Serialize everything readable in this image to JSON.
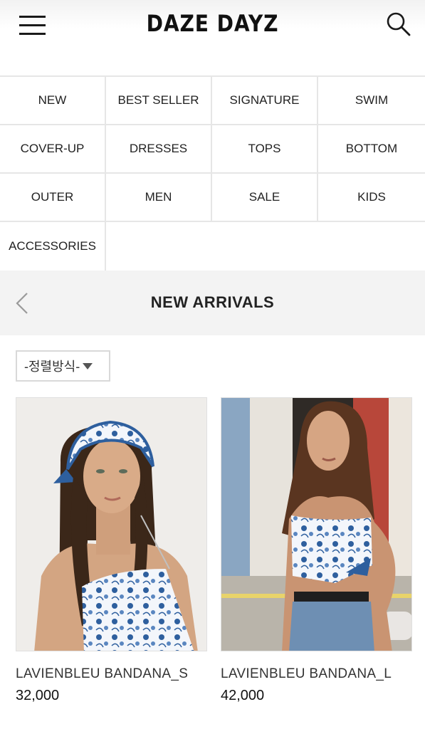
{
  "header": {
    "logo": "DAZE DAYZ",
    "menu_icon": "hamburger-menu-icon",
    "search_icon": "search-icon"
  },
  "categories": [
    "NEW",
    "BEST SELLER",
    "SIGNATURE",
    "SWIM",
    "COVER-UP",
    "DRESSES",
    "TOPS",
    "BOTTOM",
    "OUTER",
    "MEN",
    "SALE",
    "KIDS",
    "ACCESSORIES"
  ],
  "section": {
    "title": "NEW ARRIVALS",
    "back_icon": "chevron-left-icon"
  },
  "sort": {
    "label": "-정렬방식-"
  },
  "products": [
    {
      "name": "LAVIENBLEU BANDANA_S",
      "price": "32,000"
    },
    {
      "name": "LAVIENBLEU BANDANA_L",
      "price": "42,000"
    }
  ],
  "colors": {
    "text": "#1a1a1a",
    "border": "#e6e6e6",
    "section_bg": "#f3f3f3",
    "print_blue": "#2e5f9e"
  }
}
